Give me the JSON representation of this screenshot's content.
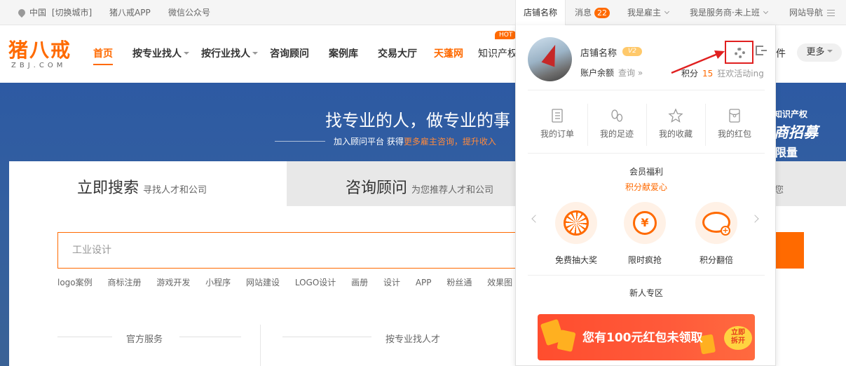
{
  "topbar": {
    "city": "中国",
    "switch_city": "[切换城市]",
    "app": "猪八戒APP",
    "wechat": "微信公众号",
    "shop_tab": "店铺名称",
    "messages": "消息",
    "message_count": "22",
    "employer": "我是雇主",
    "provider": "我是服务商·未上班",
    "site_nav": "网站导航"
  },
  "nav": {
    "logo_cn": "猪八戒",
    "logo_en": "ZBJ.COM",
    "items": [
      "首页",
      "按专业找人",
      "按行业找人",
      "咨询顾问",
      "案例库",
      "交易大厅",
      "天蓬网",
      "知识产权"
    ],
    "hot": "HOT",
    "partial": "件",
    "more": "更多"
  },
  "banner": {
    "title": "找专业的人，做专业的事",
    "sub_prefix": "加入顾问平台 获得",
    "sub_highlight": "更多雇主咨询，提升收入",
    "promo_top": "知识产权",
    "promo_big": "商招募",
    "promo_small": "限量"
  },
  "search": {
    "tab1_main": "立即搜索",
    "tab1_sub": "寻找人才和公司",
    "tab2_main": "咨询顾问",
    "tab2_sub": "为您推荐人才和公司",
    "tab2_tail": "您",
    "placeholder": "工业设计",
    "hot_words": [
      "logo案例",
      "商标注册",
      "游戏开发",
      "小程序",
      "网站建设",
      "LOGO设计",
      "画册",
      "设计",
      "APP",
      "粉丝通",
      "效果图"
    ],
    "section_official": "官方服务",
    "section_pro": "按专业找人才"
  },
  "popup": {
    "shop_name": "店铺名称",
    "level": "V2",
    "balance_label": "账户余额",
    "balance_query": "查询 »",
    "points_label": "积分",
    "points_value": "15",
    "points_activity": "狂欢活动ing",
    "quick_links": [
      "我的订单",
      "我的足迹",
      "我的收藏",
      "我的红包"
    ],
    "benefit_title": "会员福利",
    "benefit_sub": "积分献爱心",
    "benefits": [
      "免费抽大奖",
      "限时疯抢",
      "积分翻倍"
    ],
    "newbie_title": "新人专区",
    "redpack_text": "您有100元红包未领取",
    "redpack_open_1": "立即",
    "redpack_open_2": "拆开"
  }
}
